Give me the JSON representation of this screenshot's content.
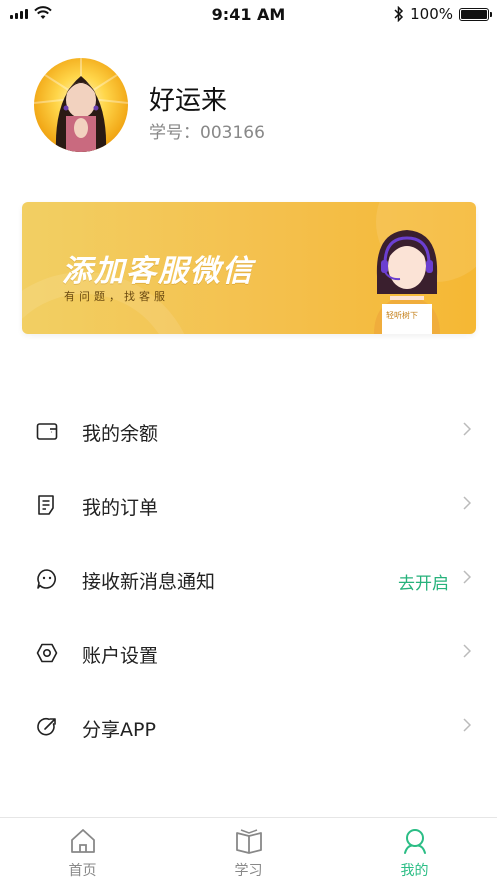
{
  "status_bar": {
    "time": "9:41 AM",
    "battery": "100%",
    "icons": [
      "signal-icon",
      "wifi-icon",
      "bluetooth-icon",
      "battery-icon"
    ]
  },
  "profile": {
    "username": "好运来",
    "id_label": "学号：",
    "id_value": "003166"
  },
  "banner": {
    "title": "添加客服微信",
    "subtitle": "有问题，找客服",
    "sign_text": "轻听树下"
  },
  "menu": {
    "items": [
      {
        "label": "我的余额",
        "icon": "wallet-icon"
      },
      {
        "label": "我的订单",
        "icon": "order-list-icon"
      },
      {
        "label": "接收新消息通知",
        "icon": "message-bubble-icon",
        "action": "去开启"
      },
      {
        "label": "账户设置",
        "icon": "settings-icon"
      },
      {
        "label": "分享APP",
        "icon": "share-icon"
      }
    ]
  },
  "tabbar": {
    "tabs": [
      {
        "label": "首页",
        "icon": "home-icon"
      },
      {
        "label": "学习",
        "icon": "book-icon"
      },
      {
        "label": "我的",
        "icon": "user-icon",
        "active": true
      }
    ]
  },
  "colors": {
    "accent": "#2bbd85",
    "banner_gold": "#f4c04d",
    "muted_text": "#888888"
  }
}
